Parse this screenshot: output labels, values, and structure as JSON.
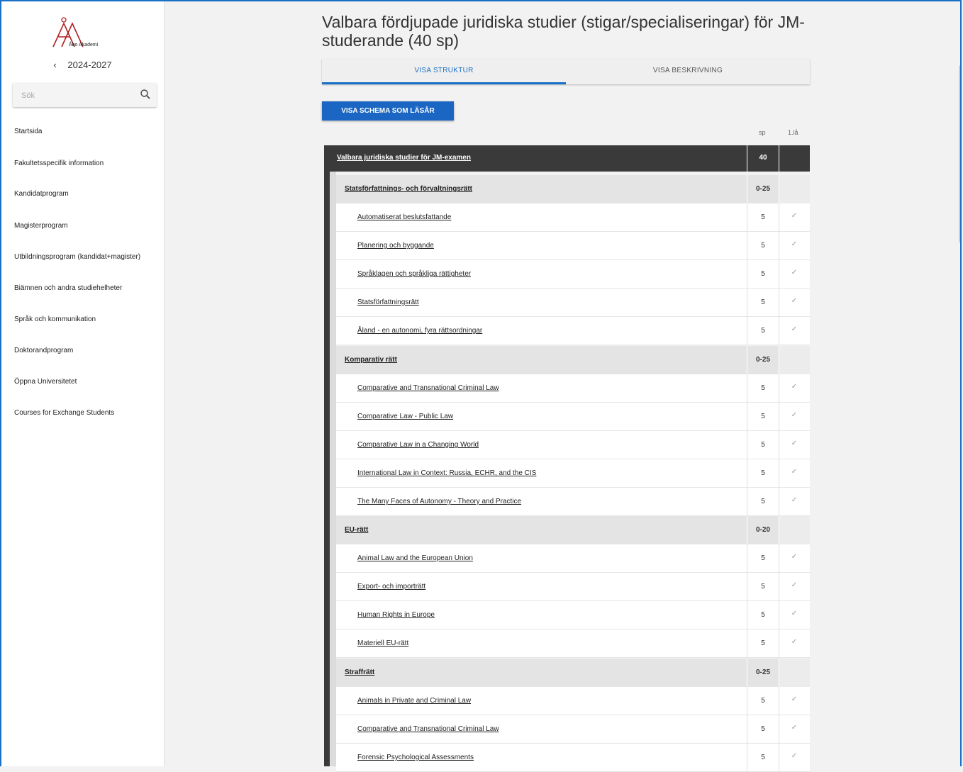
{
  "sidebar": {
    "logo_text": "Åbo Akademi",
    "year": "2024-2027",
    "back_icon": "chevron-left-icon",
    "search_placeholder": "Sök",
    "nav": [
      "Startsida",
      "Fakultetsspecifik information",
      "Kandidatprogram",
      "Magisterprogram",
      "Utbildningsprogram (kandidat+magister)",
      "Biämnen och andra studiehelheter",
      "Språk och kommunikation",
      "Doktorandprogram",
      "Öppna Universitetet",
      "Courses for Exchange Students"
    ]
  },
  "main": {
    "title": "Valbara fördjupade juridiska studier (stigar/specialiseringar) för JM-studerande (40 sp)",
    "tabs": [
      "VISA STRUKTUR",
      "VISA BESKRIVNING"
    ],
    "schema_button": "VISA SCHEMA SOM LÄSÅR",
    "col_sp": "sp",
    "col_year": "1.lå",
    "top_row": {
      "label": "Valbara juridiska studier för JM-examen",
      "sp": "40"
    },
    "groups": [
      {
        "label": "Statsförfattnings- och förvaltningsrätt",
        "sp": "0-25",
        "courses": [
          {
            "label": "Automatiserat beslutsfattande",
            "sp": "5"
          },
          {
            "label": "Planering och byggande",
            "sp": "5"
          },
          {
            "label": "Språklagen och språkliga rättigheter",
            "sp": "5"
          },
          {
            "label": "Statsförfattningsrätt",
            "sp": "5"
          },
          {
            "label": "Åland - en autonomi, fyra rättsordningar",
            "sp": "5"
          }
        ]
      },
      {
        "label": "Komparativ rätt",
        "sp": "0-25",
        "courses": [
          {
            "label": "Comparative and Transnational Criminal Law",
            "sp": "5"
          },
          {
            "label": "Comparative Law - Public Law",
            "sp": "5"
          },
          {
            "label": "Comparative Law in a Changing World",
            "sp": "5"
          },
          {
            "label": "International Law in Context: Russia, ECHR, and the CIS",
            "sp": "5"
          },
          {
            "label": "The Many Faces of Autonomy - Theory and Practice",
            "sp": "5"
          }
        ]
      },
      {
        "label": "EU-rätt",
        "sp": "0-20",
        "courses": [
          {
            "label": "Animal Law and the European Union",
            "sp": "5"
          },
          {
            "label": "Export- och importrätt",
            "sp": "5"
          },
          {
            "label": "Human Rights in Europe",
            "sp": "5"
          },
          {
            "label": "Materiell EU-rätt",
            "sp": "5"
          }
        ]
      },
      {
        "label": "Straffrätt",
        "sp": "0-25",
        "courses": [
          {
            "label": "Animals in Private and Criminal Law",
            "sp": "5"
          },
          {
            "label": "Comparative and Transnational Criminal Law",
            "sp": "5"
          },
          {
            "label": "Forensic Psychological Assessments",
            "sp": "5"
          }
        ]
      }
    ],
    "check_mark": "✓"
  }
}
